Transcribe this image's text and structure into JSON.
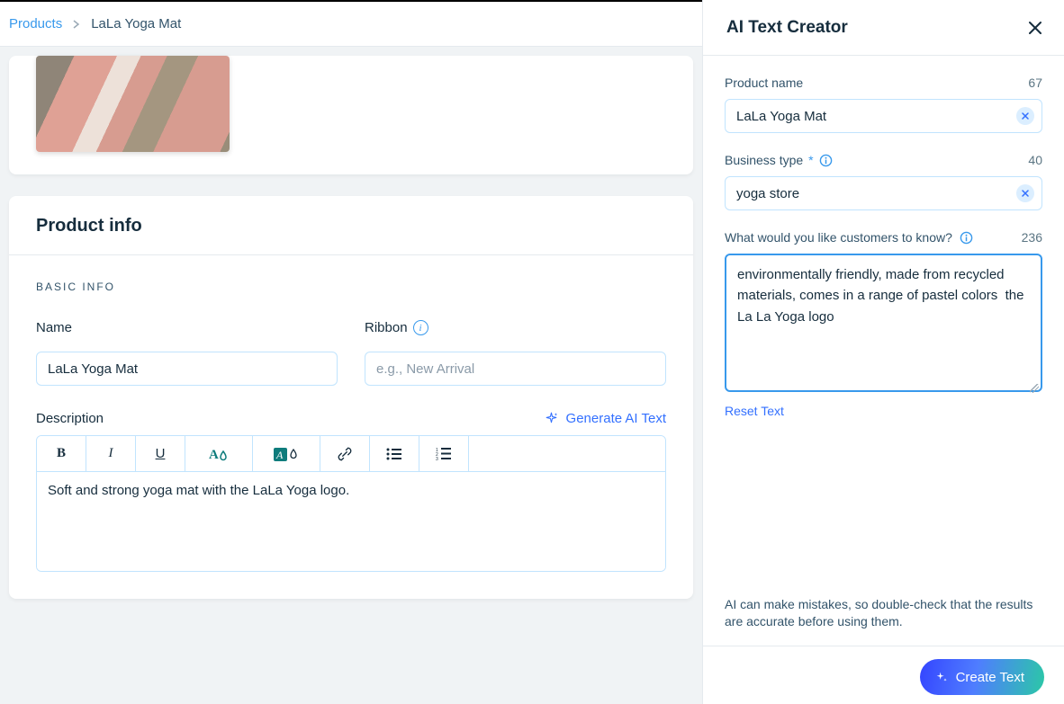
{
  "breadcrumb": {
    "root": "Products",
    "current": "LaLa Yoga Mat"
  },
  "card": {
    "info_title": "Product info",
    "section_label": "BASIC INFO",
    "name_label": "Name",
    "name_value": "LaLa Yoga Mat",
    "ribbon_label": "Ribbon",
    "ribbon_placeholder": "e.g., New Arrival",
    "description_label": "Description",
    "generate_ai_text": "Generate AI Text",
    "description_value": "Soft and strong yoga mat with the LaLa Yoga logo."
  },
  "ai": {
    "title": "AI Text Creator",
    "product_name_label": "Product name",
    "product_name_value": "LaLa Yoga Mat",
    "product_name_counter": "67",
    "business_type_label": "Business type",
    "business_type_value": "yoga store",
    "business_type_counter": "40",
    "know_label": "What would you like customers to know?",
    "know_counter": "236",
    "know_value": "environmentally friendly, made from recycled materials, comes in a range of pastel colors  the La La Yoga logo",
    "reset_text": "Reset Text",
    "disclaimer": "AI can make mistakes, so double-check that the results are accurate before using them.",
    "create_btn": "Create Text"
  }
}
